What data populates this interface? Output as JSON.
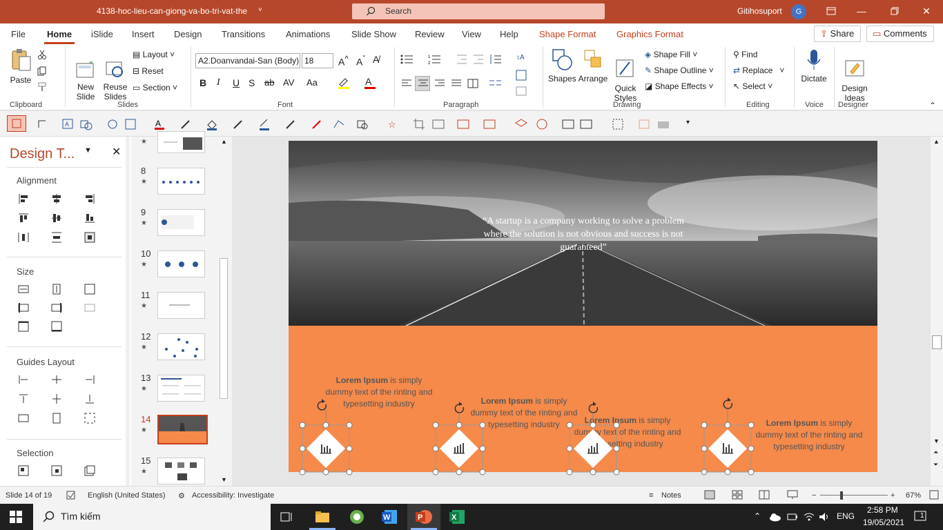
{
  "titlebar": {
    "doc_name": "4138-hoc-lieu-can-giong-va-bo-tri-vat-the",
    "dropdown": "˅",
    "search_placeholder": "Search",
    "user": "Gitihosuport",
    "avatar": "G"
  },
  "menu": {
    "tabs": [
      "File",
      "Home",
      "iSlide",
      "Insert",
      "Design",
      "Transitions",
      "Animations",
      "Slide Show",
      "Review",
      "View",
      "Help",
      "Shape Format",
      "Graphics Format"
    ],
    "share": "Share",
    "comments": "Comments"
  },
  "ribbon": {
    "clipboard": {
      "paste": "Paste",
      "label": "Clipboard"
    },
    "slides": {
      "new_slide": "New\nSlide",
      "reuse": "Reuse\nSlides",
      "layout": "Layout",
      "reset": "Reset",
      "section": "Section",
      "label": "Slides"
    },
    "font": {
      "name": "A2.Doanvandai-San (Body)",
      "size": "18",
      "label": "Font",
      "bold": "B",
      "italic": "I",
      "underline": "U",
      "shadow": "S",
      "strike": "ab",
      "spacing": "AV",
      "case": "Aa"
    },
    "paragraph": {
      "label": "Paragraph"
    },
    "drawing": {
      "shapes": "Shapes",
      "arrange": "Arrange",
      "quick_styles": "Quick\nStyles",
      "shape_fill": "Shape Fill",
      "shape_outline": "Shape Outline",
      "shape_effects": "Shape Effects",
      "label": "Drawing"
    },
    "editing": {
      "find": "Find",
      "replace": "Replace",
      "select": "Select",
      "label": "Editing"
    },
    "voice": {
      "dictate": "Dictate",
      "label": "Voice"
    },
    "designer": {
      "ideas": "Design\nIdeas",
      "label": "Designer"
    }
  },
  "leftpane": {
    "title": "Design T...",
    "sections": [
      "Alignment",
      "Size",
      "Guides Layout",
      "Selection"
    ]
  },
  "thumbnails": [
    {
      "num": "8",
      "current": false
    },
    {
      "num": "9",
      "current": false
    },
    {
      "num": "10",
      "current": false
    },
    {
      "num": "11",
      "current": false
    },
    {
      "num": "12",
      "current": false
    },
    {
      "num": "13",
      "current": false
    },
    {
      "num": "14",
      "current": true
    },
    {
      "num": "15",
      "current": false
    }
  ],
  "slide": {
    "quote": "“A startup is a company working to solve a problem where the solution is not obvious and success is not guaranteed”",
    "items": [
      {
        "bold": "Lorem Ipsum",
        "text": " is simply dummy text of the rinting and typesetting industry"
      },
      {
        "bold": "Lorem Ipsum",
        "text": " is simply dummy text of the rinting and typesetting industry"
      },
      {
        "bold": "Lorem Ipsum",
        "text": " is simply dummy text of the rinting and typesetting industry"
      },
      {
        "bold": "Lorem Ipsum",
        "text": " is simply dummy text of the rinting and typesetting industry"
      }
    ]
  },
  "status": {
    "slide": "Slide 14 of 19",
    "language": "English (United States)",
    "accessibility": "Accessibility: Investigate",
    "notes": "Notes",
    "zoom": "67%"
  },
  "taskbar": {
    "search": "Tìm kiếm",
    "lang": "ENG",
    "time": "2:58 PM",
    "date": "19/05/2021",
    "notif": "1"
  },
  "colors": {
    "accent": "#b7472a",
    "orange": "#f58a4b",
    "ctx": "#c43e1c"
  }
}
